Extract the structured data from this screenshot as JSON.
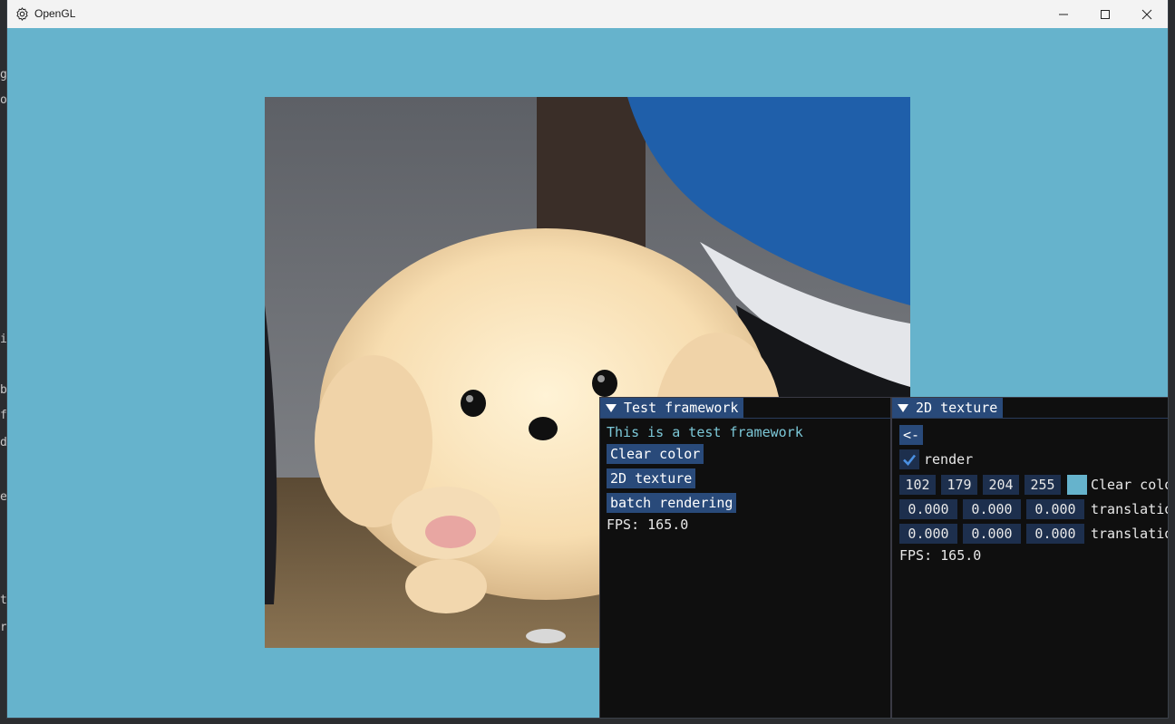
{
  "window": {
    "title": "OpenGL",
    "clear_color": "#66b3cc"
  },
  "background_fragments": [
    "g",
    "o",
    "i",
    "b",
    "f",
    "d",
    "e",
    "t",
    "r"
  ],
  "texture": {
    "description_icon": "plush-toy-image"
  },
  "test_framework": {
    "title": "Test framework",
    "subtitle": "This is a test framework",
    "buttons": [
      "Clear color",
      "2D texture",
      "batch rendering"
    ],
    "fps": "FPS: 165.0"
  },
  "texture_panel": {
    "title": "2D texture",
    "back_label": "<-",
    "render_label": "render",
    "render_checked": true,
    "color_values": [
      "102",
      "179",
      "204",
      "255"
    ],
    "color_label": "Clear colo",
    "translation_a": [
      "0.000",
      "0.000",
      "0.000"
    ],
    "translation_a_label": "translatio",
    "translation_b": [
      "0.000",
      "0.000",
      "0.000"
    ],
    "translation_b_label": "translatio",
    "fps": "FPS: 165.0"
  }
}
